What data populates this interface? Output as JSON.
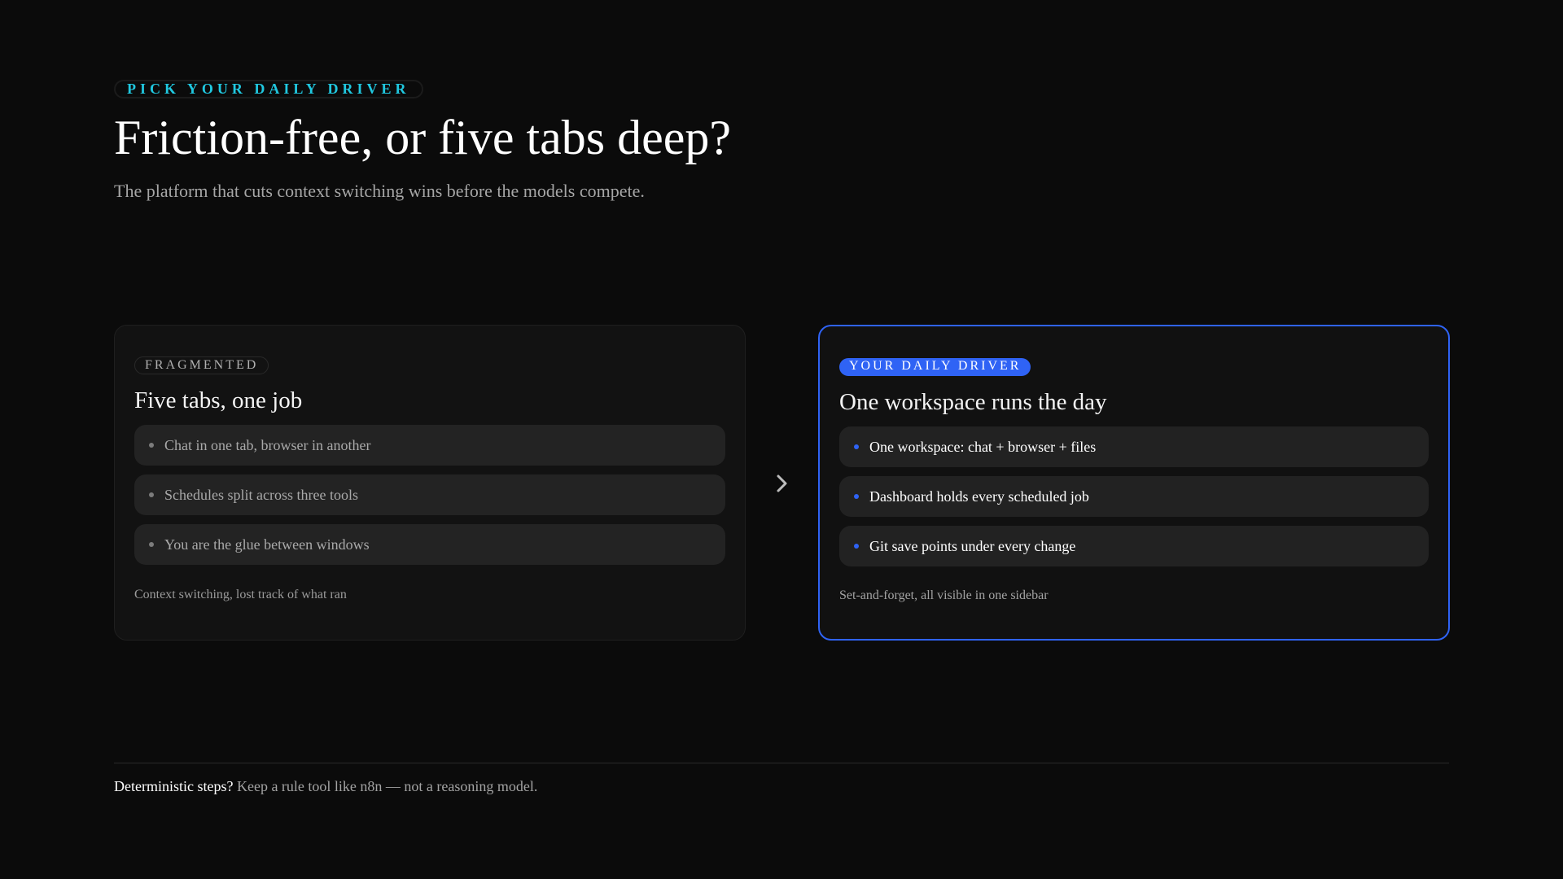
{
  "header": {
    "eyebrow": "PICK YOUR DAILY DRIVER",
    "title": "Friction-free, or five tabs deep?",
    "subtitle": "The platform that cuts context switching wins before the models compete."
  },
  "left_card": {
    "badge": "FRAGMENTED",
    "title": "Five tabs, one job",
    "items": [
      "Chat in one tab, browser in another",
      "Schedules split across three tools",
      "You are the glue between windows"
    ],
    "footnote": "Context switching, lost track of what ran"
  },
  "right_card": {
    "badge": "YOUR DAILY DRIVER",
    "title": "One workspace runs the day",
    "items": [
      "One workspace: chat + browser + files",
      "Dashboard holds every scheduled job",
      "Git save points under every change"
    ],
    "footnote": "Set-and-forget, all visible in one sidebar"
  },
  "arrow_icon": "chevron-right-icon",
  "bottom_note": {
    "lead": "Deterministic steps?",
    "rest": " Keep a rule tool like n8n — not a reasoning model."
  },
  "colors": {
    "accent_cyan": "#20c8e0",
    "accent_blue": "#2f63f5",
    "background": "#0b0b0b"
  }
}
